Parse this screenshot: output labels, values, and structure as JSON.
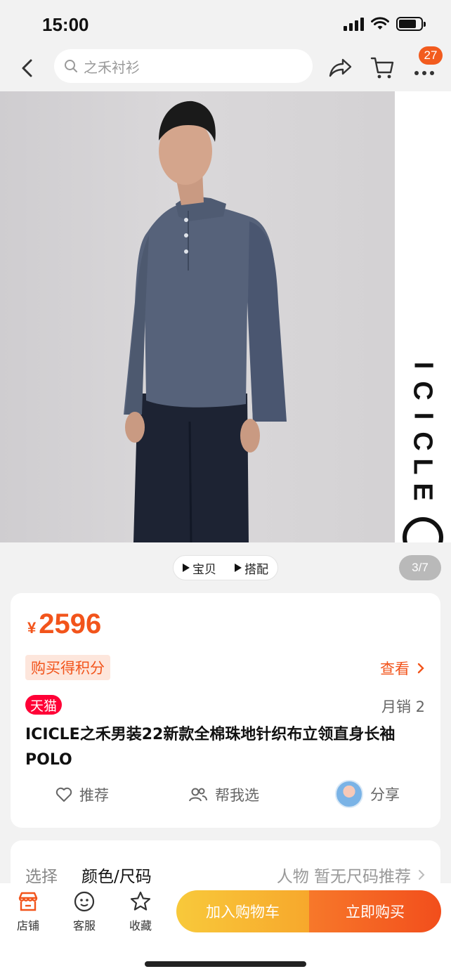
{
  "status": {
    "time": "15:00"
  },
  "nav": {
    "search_placeholder": "之禾衬衫",
    "message_count": "27"
  },
  "hero": {
    "brand_vertical": [
      "I",
      "C",
      "I",
      "C",
      "L",
      "E"
    ],
    "tabs": [
      "宝贝",
      "搭配"
    ],
    "counter": "3/7"
  },
  "product": {
    "currency": "¥",
    "price": "2596",
    "points_tag": "购买得积分",
    "view_label": "查看",
    "tmall_tag": "天猫",
    "monthly_sales": "月销 2",
    "title": "ICICLE之禾男装22新款全棉珠地针织布立领直身长袖POLO",
    "actions": {
      "recommend": "推荐",
      "help_choose": "帮我选",
      "share": "分享"
    }
  },
  "select": {
    "label": "选择",
    "value": "颜色/尺码",
    "size_hint": "人物 暂无尺码推荐"
  },
  "bottom": {
    "tools": {
      "store": "店铺",
      "service": "客服",
      "favorite": "收藏"
    },
    "add_cart": "加入购物车",
    "buy_now": "立即购买"
  },
  "colors": {
    "accent": "#f2541b",
    "tmall": "#ff0036",
    "cart_btn": "#f8c93b",
    "buy_btn": "#f24e1c"
  }
}
